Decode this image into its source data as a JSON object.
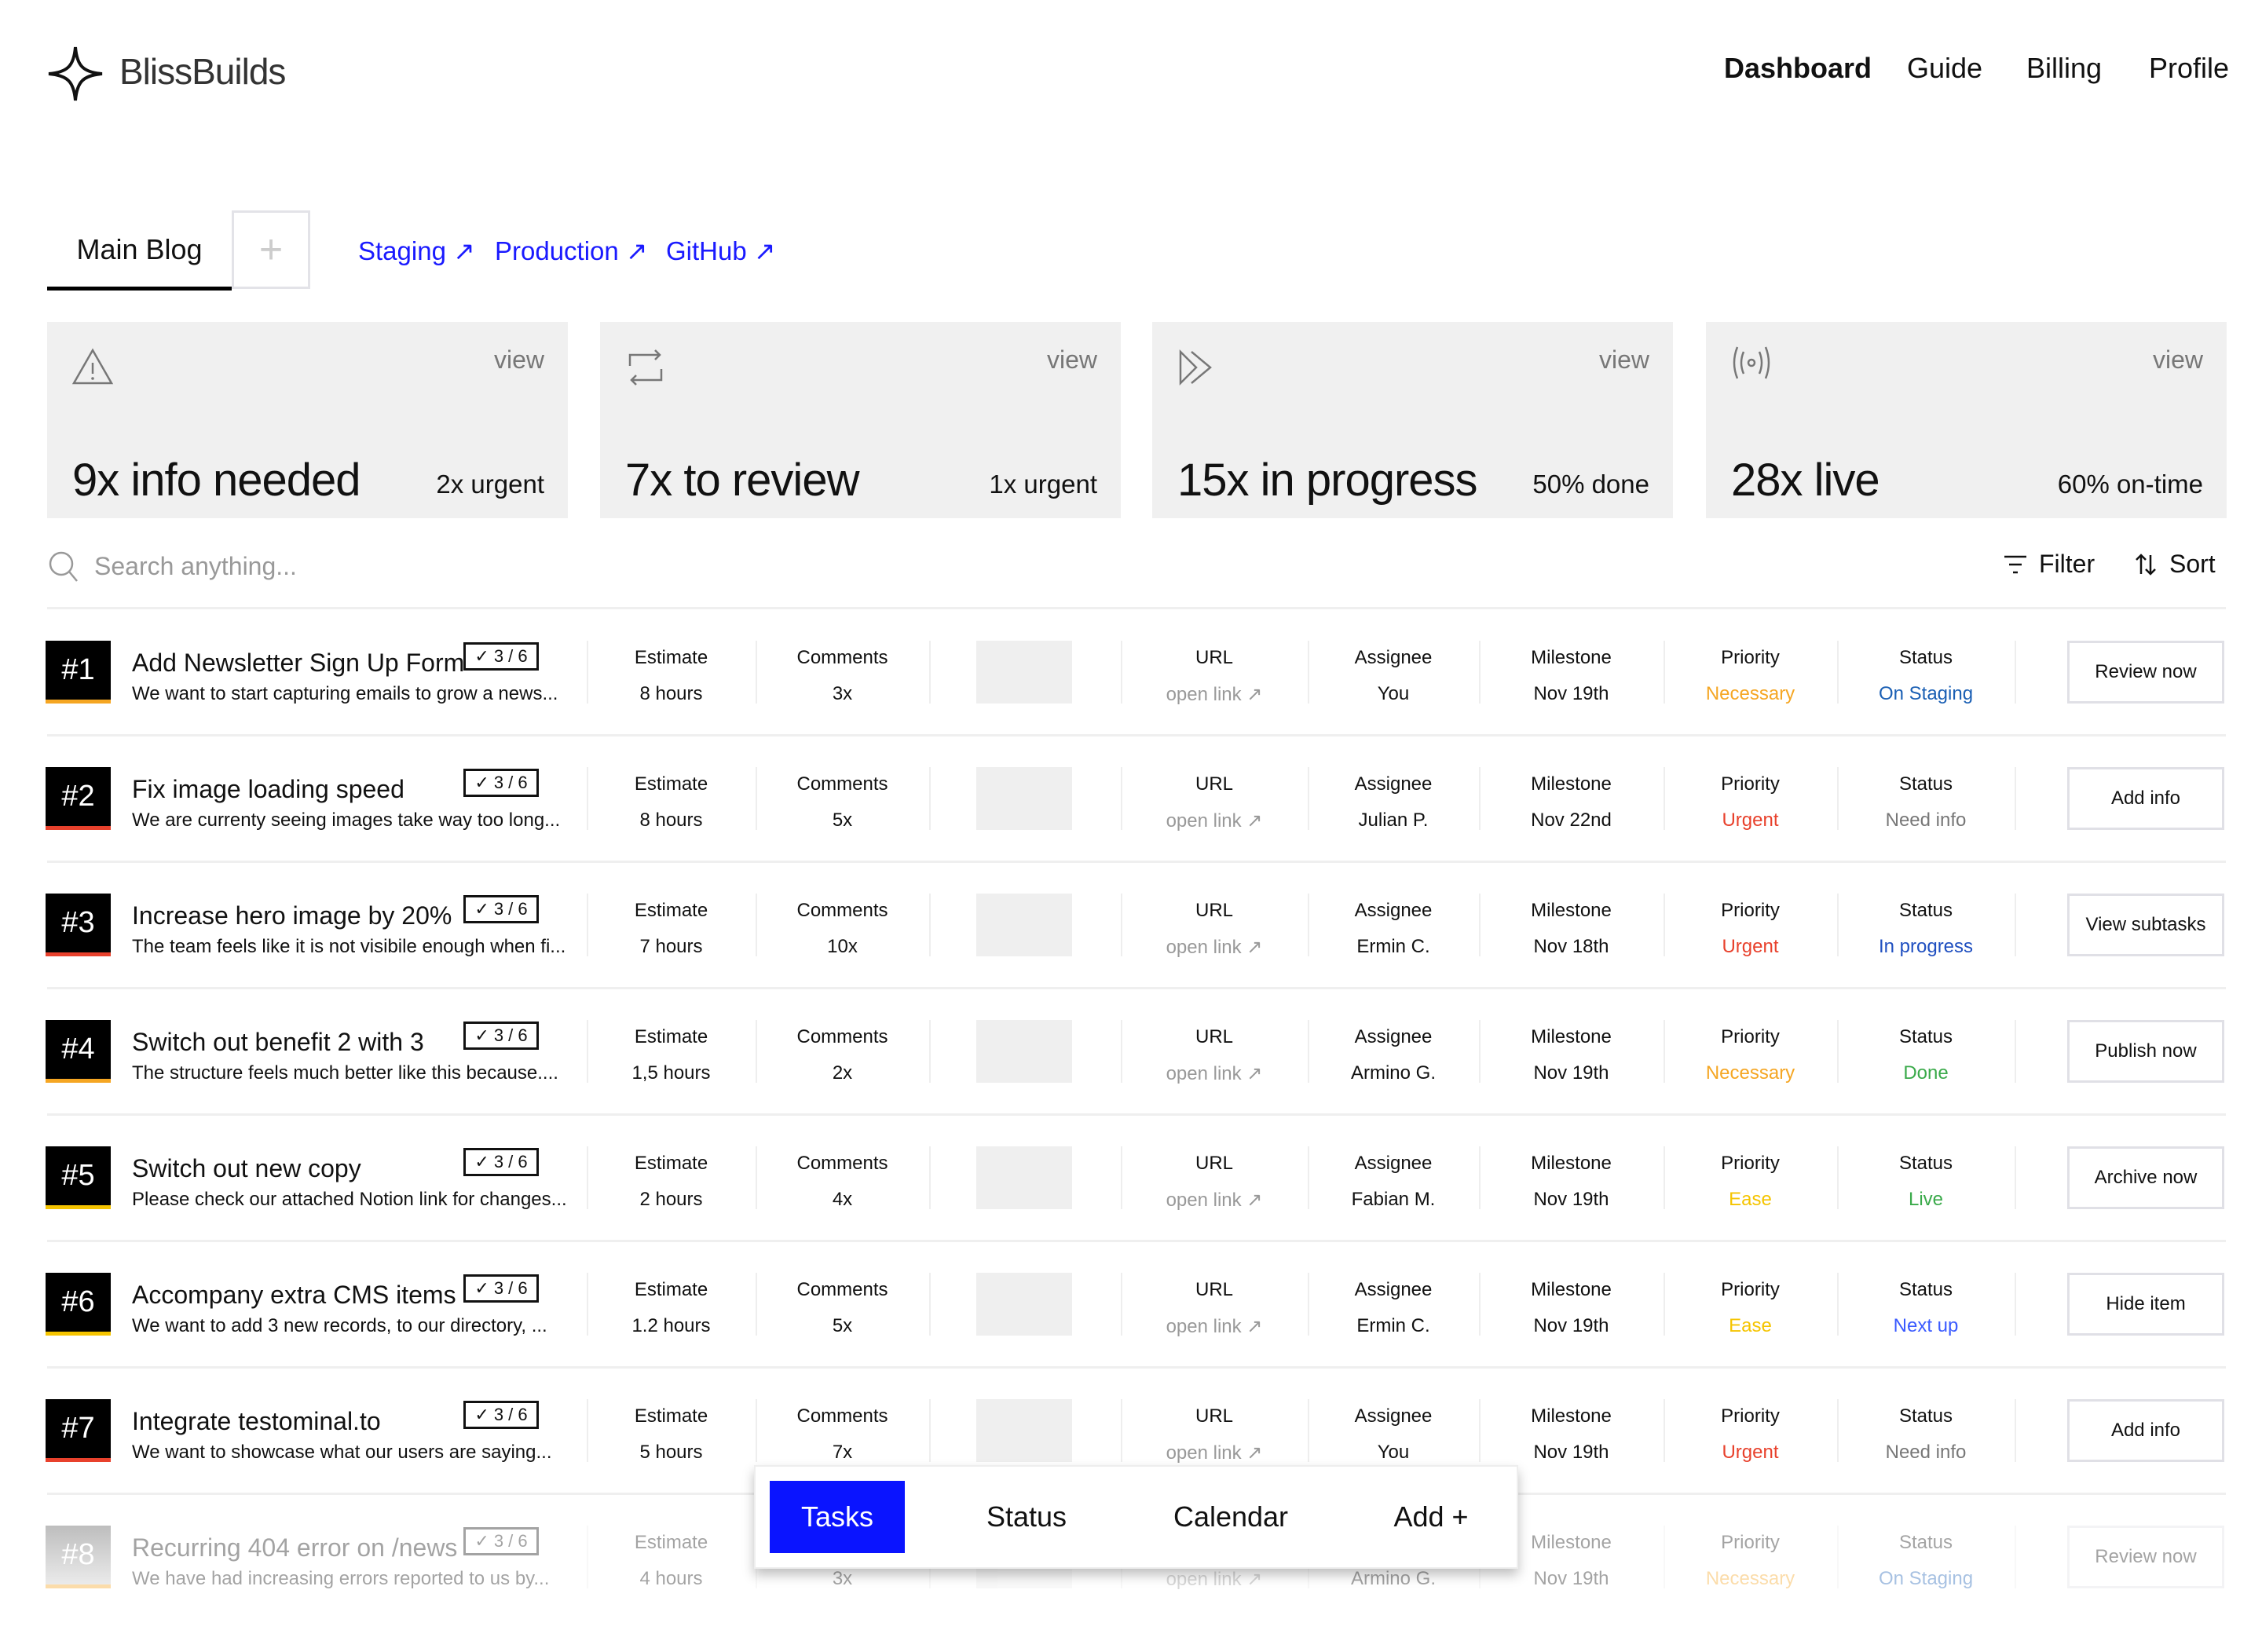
{
  "brand": {
    "name": "BlissBuilds",
    "logo_icon": "four-point-star-icon"
  },
  "nav": [
    "Dashboard",
    "Guide",
    "Billing",
    "Profile"
  ],
  "project_tabs": {
    "active": "Main Blog",
    "add": "+"
  },
  "links": [
    {
      "label": "Staging ↗"
    },
    {
      "label": "Production ↗"
    },
    {
      "label": "GitHub ↗"
    }
  ],
  "cards": [
    {
      "icon": "warning-icon",
      "view": "view",
      "title": "9x info needed",
      "sub": "2x urgent"
    },
    {
      "icon": "repeat-icon",
      "view": "view",
      "title": "7x to review",
      "sub": "1x urgent"
    },
    {
      "icon": "fast-forward-icon",
      "view": "view",
      "title": "15x in progress",
      "sub": "50% done"
    },
    {
      "icon": "broadcast-icon",
      "view": "view",
      "title": "28x live",
      "sub": "60% on-time"
    }
  ],
  "search": {
    "placeholder": "Search anything..."
  },
  "toolbar": {
    "filter": "Filter",
    "sort": "Sort"
  },
  "columns": {
    "estimate": "Estimate",
    "comments": "Comments",
    "url": "URL",
    "assignee": "Assignee",
    "milestone": "Milestone",
    "priority": "Priority",
    "status": "Status",
    "url_value": "open link ↗"
  },
  "colors": {
    "Necessary": "#f5a623",
    "Urgent": "#e8412c",
    "Ease": "#f5c400",
    "On Staging": "#1a5fb4",
    "Need info": "#777777",
    "In progress": "#1f4fc0",
    "Done": "#3aaa4a",
    "Live": "#3aaa4a",
    "Next up": "#3b5bff",
    "accent": "#0a14ff",
    "link": "#1a1aff"
  },
  "tasks": [
    {
      "num": "#1",
      "title": "Add Newsletter Sign Up Form",
      "desc": "We want to start capturing emails to grow a news...",
      "checks": "3 / 6",
      "estimate": "8 hours",
      "comments": "3x",
      "assignee": "You",
      "milestone": "Nov 19th",
      "priority": "Necessary",
      "status": "On Staging",
      "action": "Review now"
    },
    {
      "num": "#2",
      "title": "Fix image loading speed",
      "desc": "We are currenty seeing images take way too long...",
      "checks": "3 / 6",
      "estimate": "8 hours",
      "comments": "5x",
      "assignee": "Julian P.",
      "milestone": "Nov 22nd",
      "priority": "Urgent",
      "status": "Need info",
      "action": "Add info"
    },
    {
      "num": "#3",
      "title": "Increase hero image by 20%",
      "desc": "The team feels like it is not visibile enough when fi...",
      "checks": "3 / 6",
      "estimate": "7 hours",
      "comments": "10x",
      "assignee": "Ermin C.",
      "milestone": "Nov 18th",
      "priority": "Urgent",
      "status": "In progress",
      "action": "View subtasks"
    },
    {
      "num": "#4",
      "title": "Switch out benefit 2 with 3",
      "desc": "The structure feels much better like this because....",
      "checks": "3 / 6",
      "estimate": "1,5 hours",
      "comments": "2x",
      "assignee": "Armino G.",
      "milestone": "Nov 19th",
      "priority": "Necessary",
      "status": "Done",
      "action": "Publish now"
    },
    {
      "num": "#5",
      "title": "Switch out new copy",
      "desc": "Please check our attached Notion link for changes...",
      "checks": "3 / 6",
      "estimate": "2 hours",
      "comments": "4x",
      "assignee": "Fabian M.",
      "milestone": "Nov 19th",
      "priority": "Ease",
      "status": "Live",
      "action": "Archive now"
    },
    {
      "num": "#6",
      "title": "Accompany extra CMS items",
      "desc": "We want to add 3 new records, to our directory, ...",
      "checks": "3 / 6",
      "estimate": "1.2 hours",
      "comments": "5x",
      "assignee": "Ermin C.",
      "milestone": "Nov 19th",
      "priority": "Ease",
      "status": "Next up",
      "action": "Hide item"
    },
    {
      "num": "#7",
      "title": "Integrate testominal.to",
      "desc": "We want to showcase what our users are saying...",
      "checks": "3 / 6",
      "estimate": "5 hours",
      "comments": "7x",
      "assignee": "You",
      "milestone": "Nov 19th",
      "priority": "Urgent",
      "status": "Need info",
      "action": "Add info"
    },
    {
      "num": "#8",
      "title": "Recurring 404 error on /news",
      "desc": "We have had increasing errors reported to us by...",
      "checks": "3 / 6",
      "estimate": "4 hours",
      "comments": "3x",
      "assignee": "Armino G.",
      "milestone": "Nov 19th",
      "priority": "Necessary",
      "status": "On Staging",
      "action": "Review now"
    }
  ],
  "bottom_bar": {
    "active": "Tasks",
    "items": [
      "Tasks",
      "Status",
      "Calendar",
      "Add +"
    ]
  }
}
